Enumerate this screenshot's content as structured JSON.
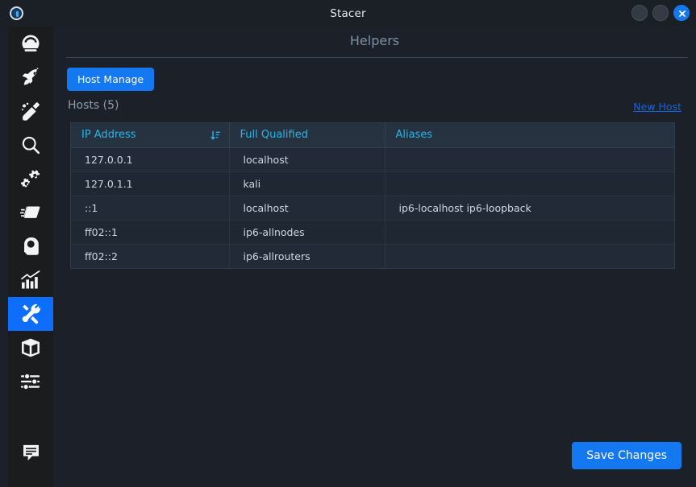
{
  "window": {
    "title": "Stacer",
    "app_icon": "stacer-logo-icon",
    "controls": [
      {
        "name": "minimize-button",
        "icon": "minimize-icon",
        "label": ""
      },
      {
        "name": "maximize-button",
        "icon": "maximize-icon",
        "label": ""
      },
      {
        "name": "close-button",
        "icon": "close-icon",
        "label": ""
      }
    ]
  },
  "sidebar": {
    "items": [
      {
        "name": "sidebar-item-dashboard",
        "icon": "speedometer-icon",
        "label": "Dashboard",
        "active": false
      },
      {
        "name": "sidebar-item-startup",
        "icon": "rocket-icon",
        "label": "Startup Apps",
        "active": false
      },
      {
        "name": "sidebar-item-cleaner",
        "icon": "broom-icon",
        "label": "System Cleaner",
        "active": false
      },
      {
        "name": "sidebar-item-search",
        "icon": "magnifier-icon",
        "label": "Search",
        "active": false
      },
      {
        "name": "sidebar-item-services",
        "icon": "gears-icon",
        "label": "Services",
        "active": false
      },
      {
        "name": "sidebar-item-processes",
        "icon": "folder-icon",
        "label": "Processes",
        "active": false
      },
      {
        "name": "sidebar-item-uninstaller",
        "icon": "disk-icon",
        "label": "Uninstaller",
        "active": false
      },
      {
        "name": "sidebar-item-resources",
        "icon": "bar-chart-icon",
        "label": "Resources",
        "active": false
      },
      {
        "name": "sidebar-item-helpers",
        "icon": "tools-icon",
        "label": "Helpers",
        "active": true
      },
      {
        "name": "sidebar-item-packages",
        "icon": "package-icon",
        "label": "Packages",
        "active": false
      },
      {
        "name": "sidebar-item-settings",
        "icon": "sliders-icon",
        "label": "Settings",
        "active": false
      },
      {
        "name": "sidebar-item-feedback",
        "icon": "chat-icon",
        "label": "Feedback",
        "active": false
      }
    ]
  },
  "main": {
    "page_title": "Helpers",
    "host_manage_label": "Host Manage",
    "hosts_label": "Hosts (5)",
    "new_host_label": "New Host",
    "save_label": "Save Changes",
    "table": {
      "sort_icon": "sort-descending-icon",
      "columns": [
        "IP Address",
        "Full Qualified",
        "Aliases"
      ],
      "rows": [
        {
          "ip": "127.0.0.1",
          "fqdn": "localhost",
          "aliases": ""
        },
        {
          "ip": "127.0.1.1",
          "fqdn": "kali",
          "aliases": ""
        },
        {
          "ip": "::1",
          "fqdn": "localhost",
          "aliases": "ip6-localhost ip6-loopback"
        },
        {
          "ip": "ff02::1",
          "fqdn": "ip6-allnodes",
          "aliases": ""
        },
        {
          "ip": "ff02::2",
          "fqdn": "ip6-allrouters",
          "aliases": ""
        }
      ]
    }
  },
  "colors": {
    "accent": "#1478f0",
    "sidebar_active": "#0d6efd",
    "header_text": "#29b6e8",
    "link": "#1565d8",
    "window_bg": "#1c2129",
    "sidebar_bg": "#1a1c1e",
    "table_header_bg": "#26323f"
  }
}
